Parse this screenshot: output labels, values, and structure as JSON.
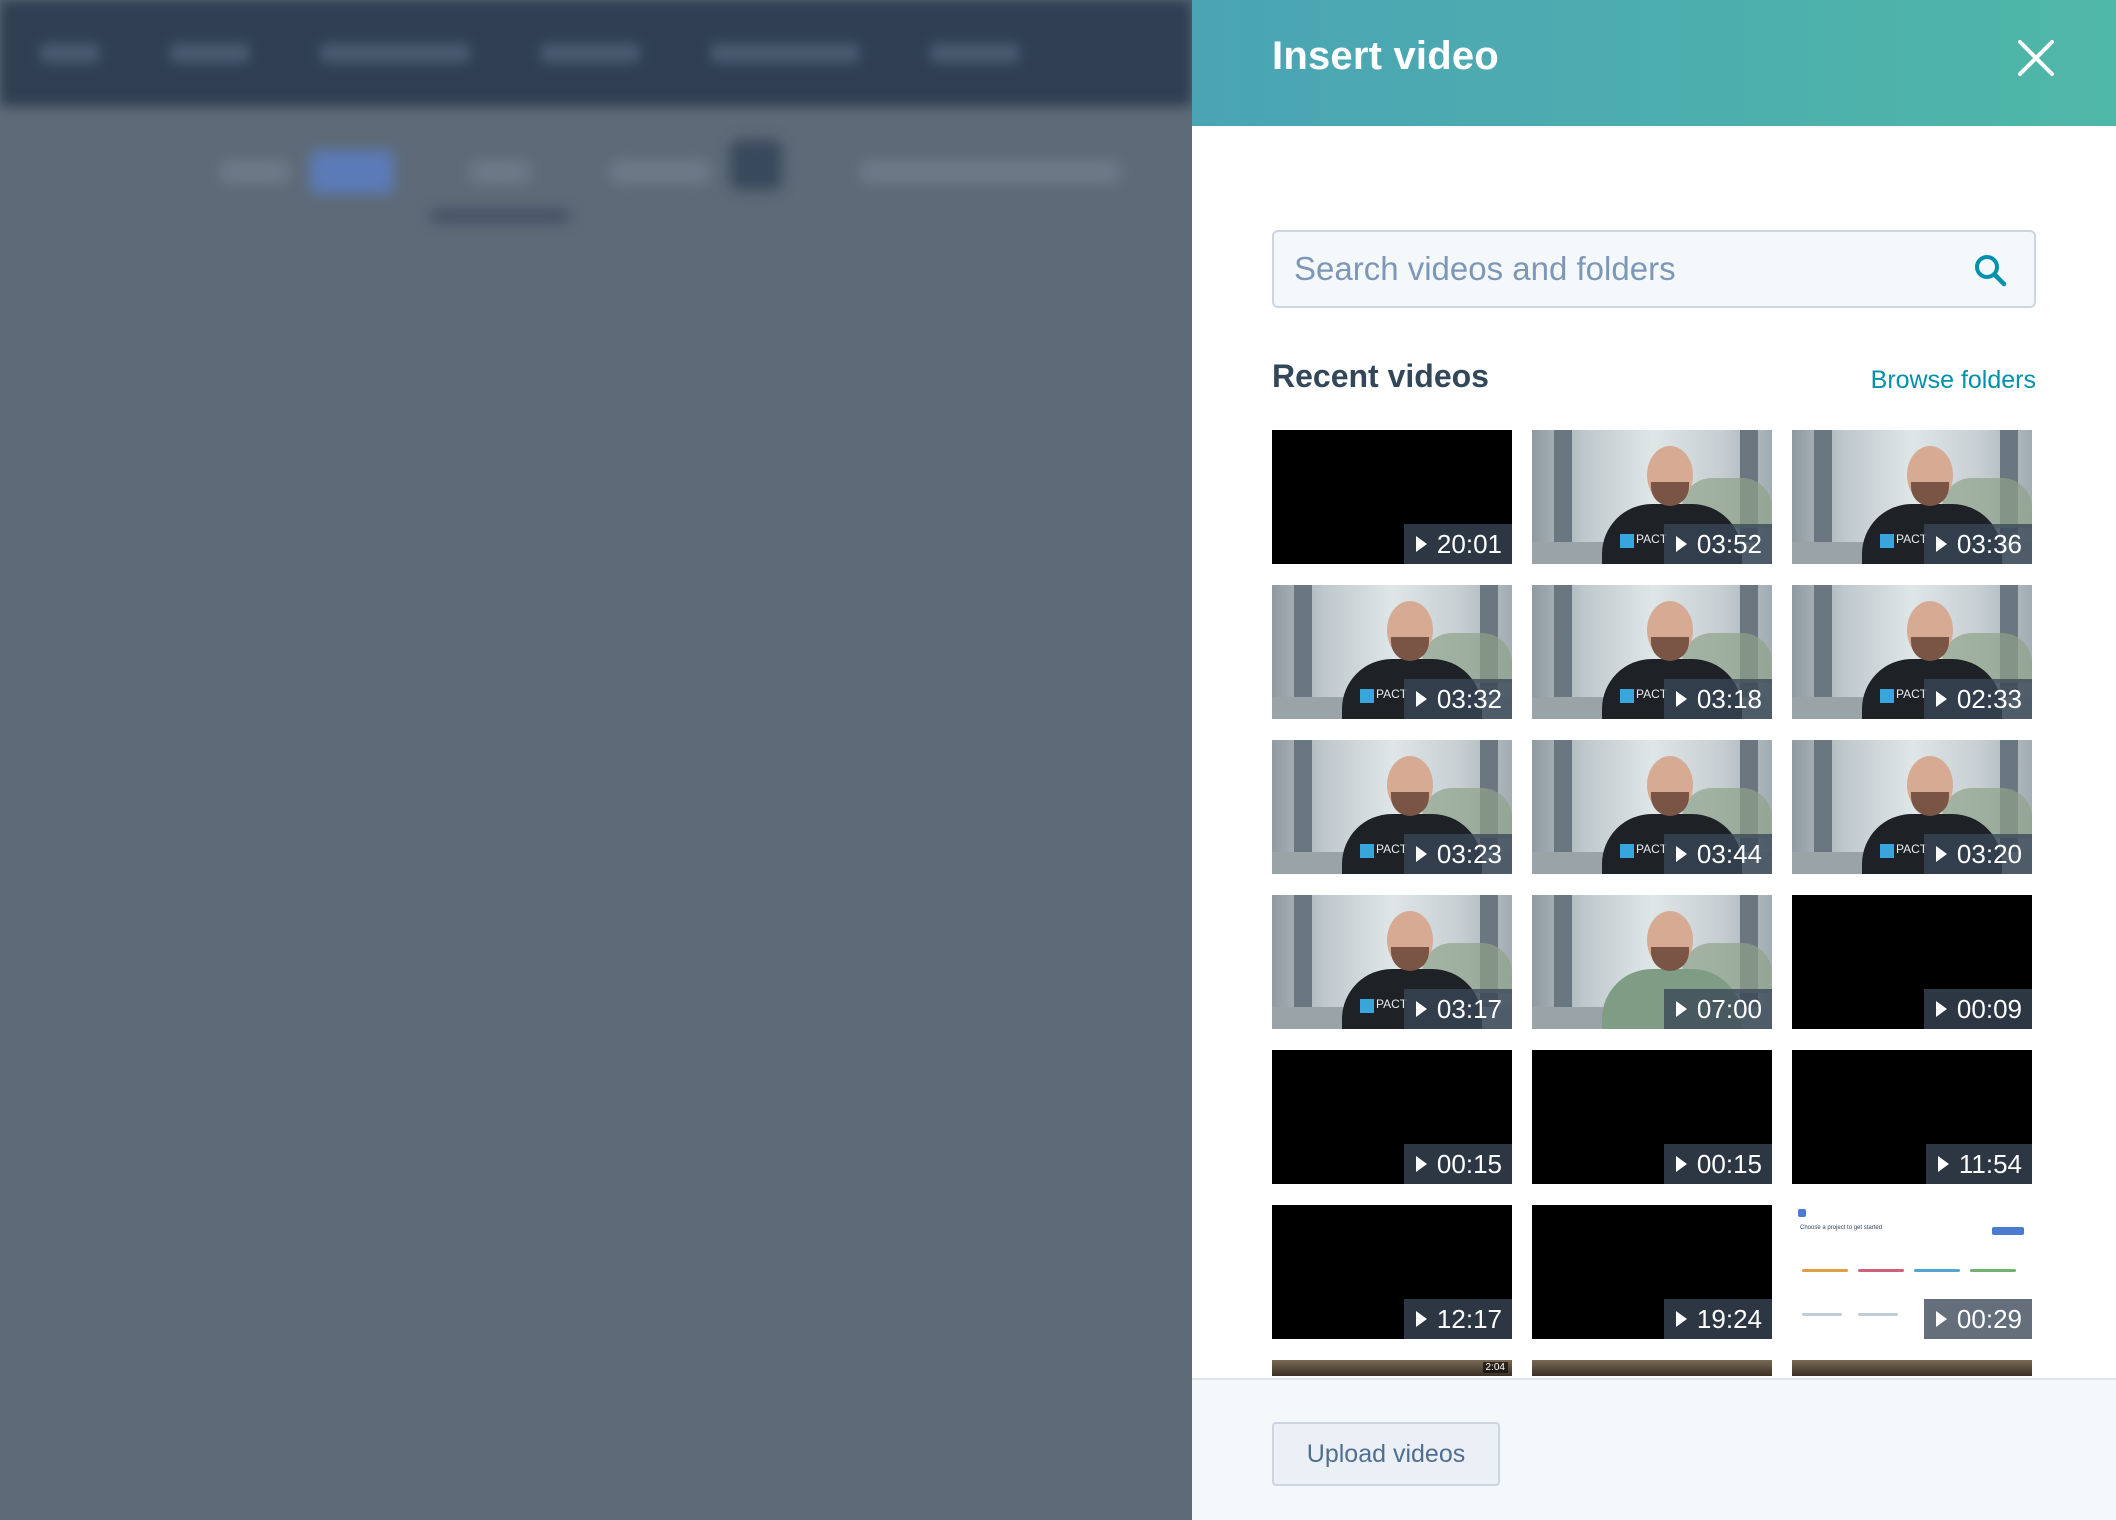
{
  "panel": {
    "title": "Insert video",
    "search_placeholder": "Search videos and folders",
    "section_title": "Recent videos",
    "browse_label": "Browse folders",
    "upload_label": "Upload videos"
  },
  "videos": [
    {
      "duration": "20:01",
      "thumb": "black"
    },
    {
      "duration": "03:52",
      "thumb": "person"
    },
    {
      "duration": "03:36",
      "thumb": "person"
    },
    {
      "duration": "03:32",
      "thumb": "person"
    },
    {
      "duration": "03:18",
      "thumb": "person"
    },
    {
      "duration": "02:33",
      "thumb": "person"
    },
    {
      "duration": "03:23",
      "thumb": "person"
    },
    {
      "duration": "03:44",
      "thumb": "person"
    },
    {
      "duration": "03:20",
      "thumb": "person"
    },
    {
      "duration": "03:17",
      "thumb": "person"
    },
    {
      "duration": "07:00",
      "thumb": "person-green"
    },
    {
      "duration": "00:09",
      "thumb": "black"
    },
    {
      "duration": "00:15",
      "thumb": "black"
    },
    {
      "duration": "00:15",
      "thumb": "black"
    },
    {
      "duration": "11:54",
      "thumb": "black"
    },
    {
      "duration": "12:17",
      "thumb": "black"
    },
    {
      "duration": "19:24",
      "thumb": "black"
    },
    {
      "duration": "00:29",
      "thumb": "screen"
    },
    {
      "duration": "",
      "thumb": "partial"
    },
    {
      "duration": "",
      "thumb": "partial"
    },
    {
      "duration": "",
      "thumb": "partial"
    }
  ],
  "thumbnail_text": {
    "logo": "PACT",
    "screen_heading": "Choose a project to get started",
    "partial_badge": "2:04"
  },
  "colors": {
    "header_start": "#4aa4b4",
    "header_end": "#4fb7a8",
    "link": "#0091ae",
    "overlay": "#5e6a77"
  },
  "icons": {
    "close": "close-icon",
    "search": "search-icon",
    "play": "play-icon"
  }
}
